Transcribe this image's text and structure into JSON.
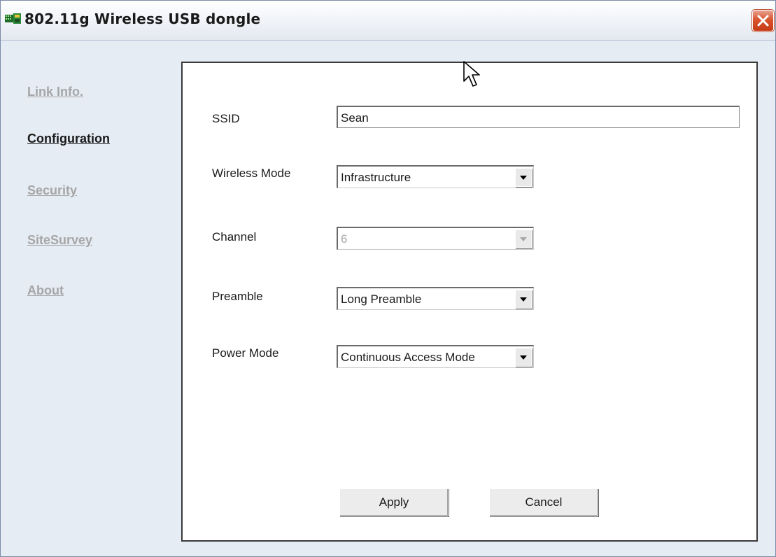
{
  "window": {
    "title": "802.11g Wireless USB dongle"
  },
  "sidebar": {
    "items": [
      {
        "label": "Link Info.",
        "active": false
      },
      {
        "label": "Configuration",
        "active": true
      },
      {
        "label": "Security",
        "active": false
      },
      {
        "label": "SiteSurvey",
        "active": false
      },
      {
        "label": "About",
        "active": false
      }
    ]
  },
  "config": {
    "ssid": {
      "label": "SSID",
      "value": "Sean"
    },
    "wireless_mode": {
      "label": "Wireless Mode",
      "value": "Infrastructure"
    },
    "channel": {
      "label": "Channel",
      "value": "6",
      "disabled": true
    },
    "preamble": {
      "label": "Preamble",
      "value": "Long Preamble"
    },
    "power_mode": {
      "label": "Power Mode",
      "value": "Continuous Access Mode"
    }
  },
  "buttons": {
    "apply": "Apply",
    "cancel": "Cancel"
  },
  "icons": {
    "app": "network-card-icon",
    "close": "close-icon",
    "cursor": "mouse-pointer-icon"
  },
  "colors": {
    "active_link": "#1a1a1a",
    "inactive_link": "#a6a6a6",
    "close_button": "#d9542e"
  }
}
